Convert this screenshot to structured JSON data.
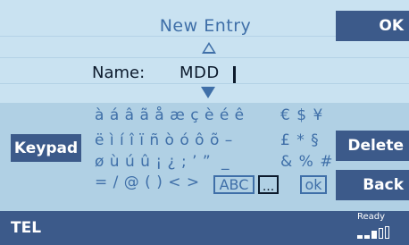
{
  "header": {
    "title": "New Entry"
  },
  "entry": {
    "label": "Name:",
    "value": "MDD"
  },
  "softkeys": {
    "ok": "OK",
    "delete": "Delete",
    "back": "Back",
    "keypad": "Keypad"
  },
  "keyboard": {
    "row1": "à á â ã å æ ç è é ê",
    "row2": "ë ì í î ï ñ ò ó ô õ –",
    "row3": "ø ù ú û ¡ ¿ ; ’ ”  _",
    "row4": "= / @ ( ) < >",
    "right1": "€ $ ¥",
    "right2": "£ * §",
    "right3": "& % #",
    "abc": "ABC",
    "ellipsis": "...",
    "ok": "ok"
  },
  "status": {
    "left": "TEL",
    "ready": "Ready",
    "signal_level": 3,
    "signal_max": 5
  },
  "colors": {
    "accent": "#3c5a8a",
    "text_blue": "#3f6fa8",
    "background": "#c9e2f1"
  },
  "icons": {
    "up": "arrow-up-icon",
    "down": "arrow-down-icon",
    "signal": "signal-strength-icon"
  }
}
